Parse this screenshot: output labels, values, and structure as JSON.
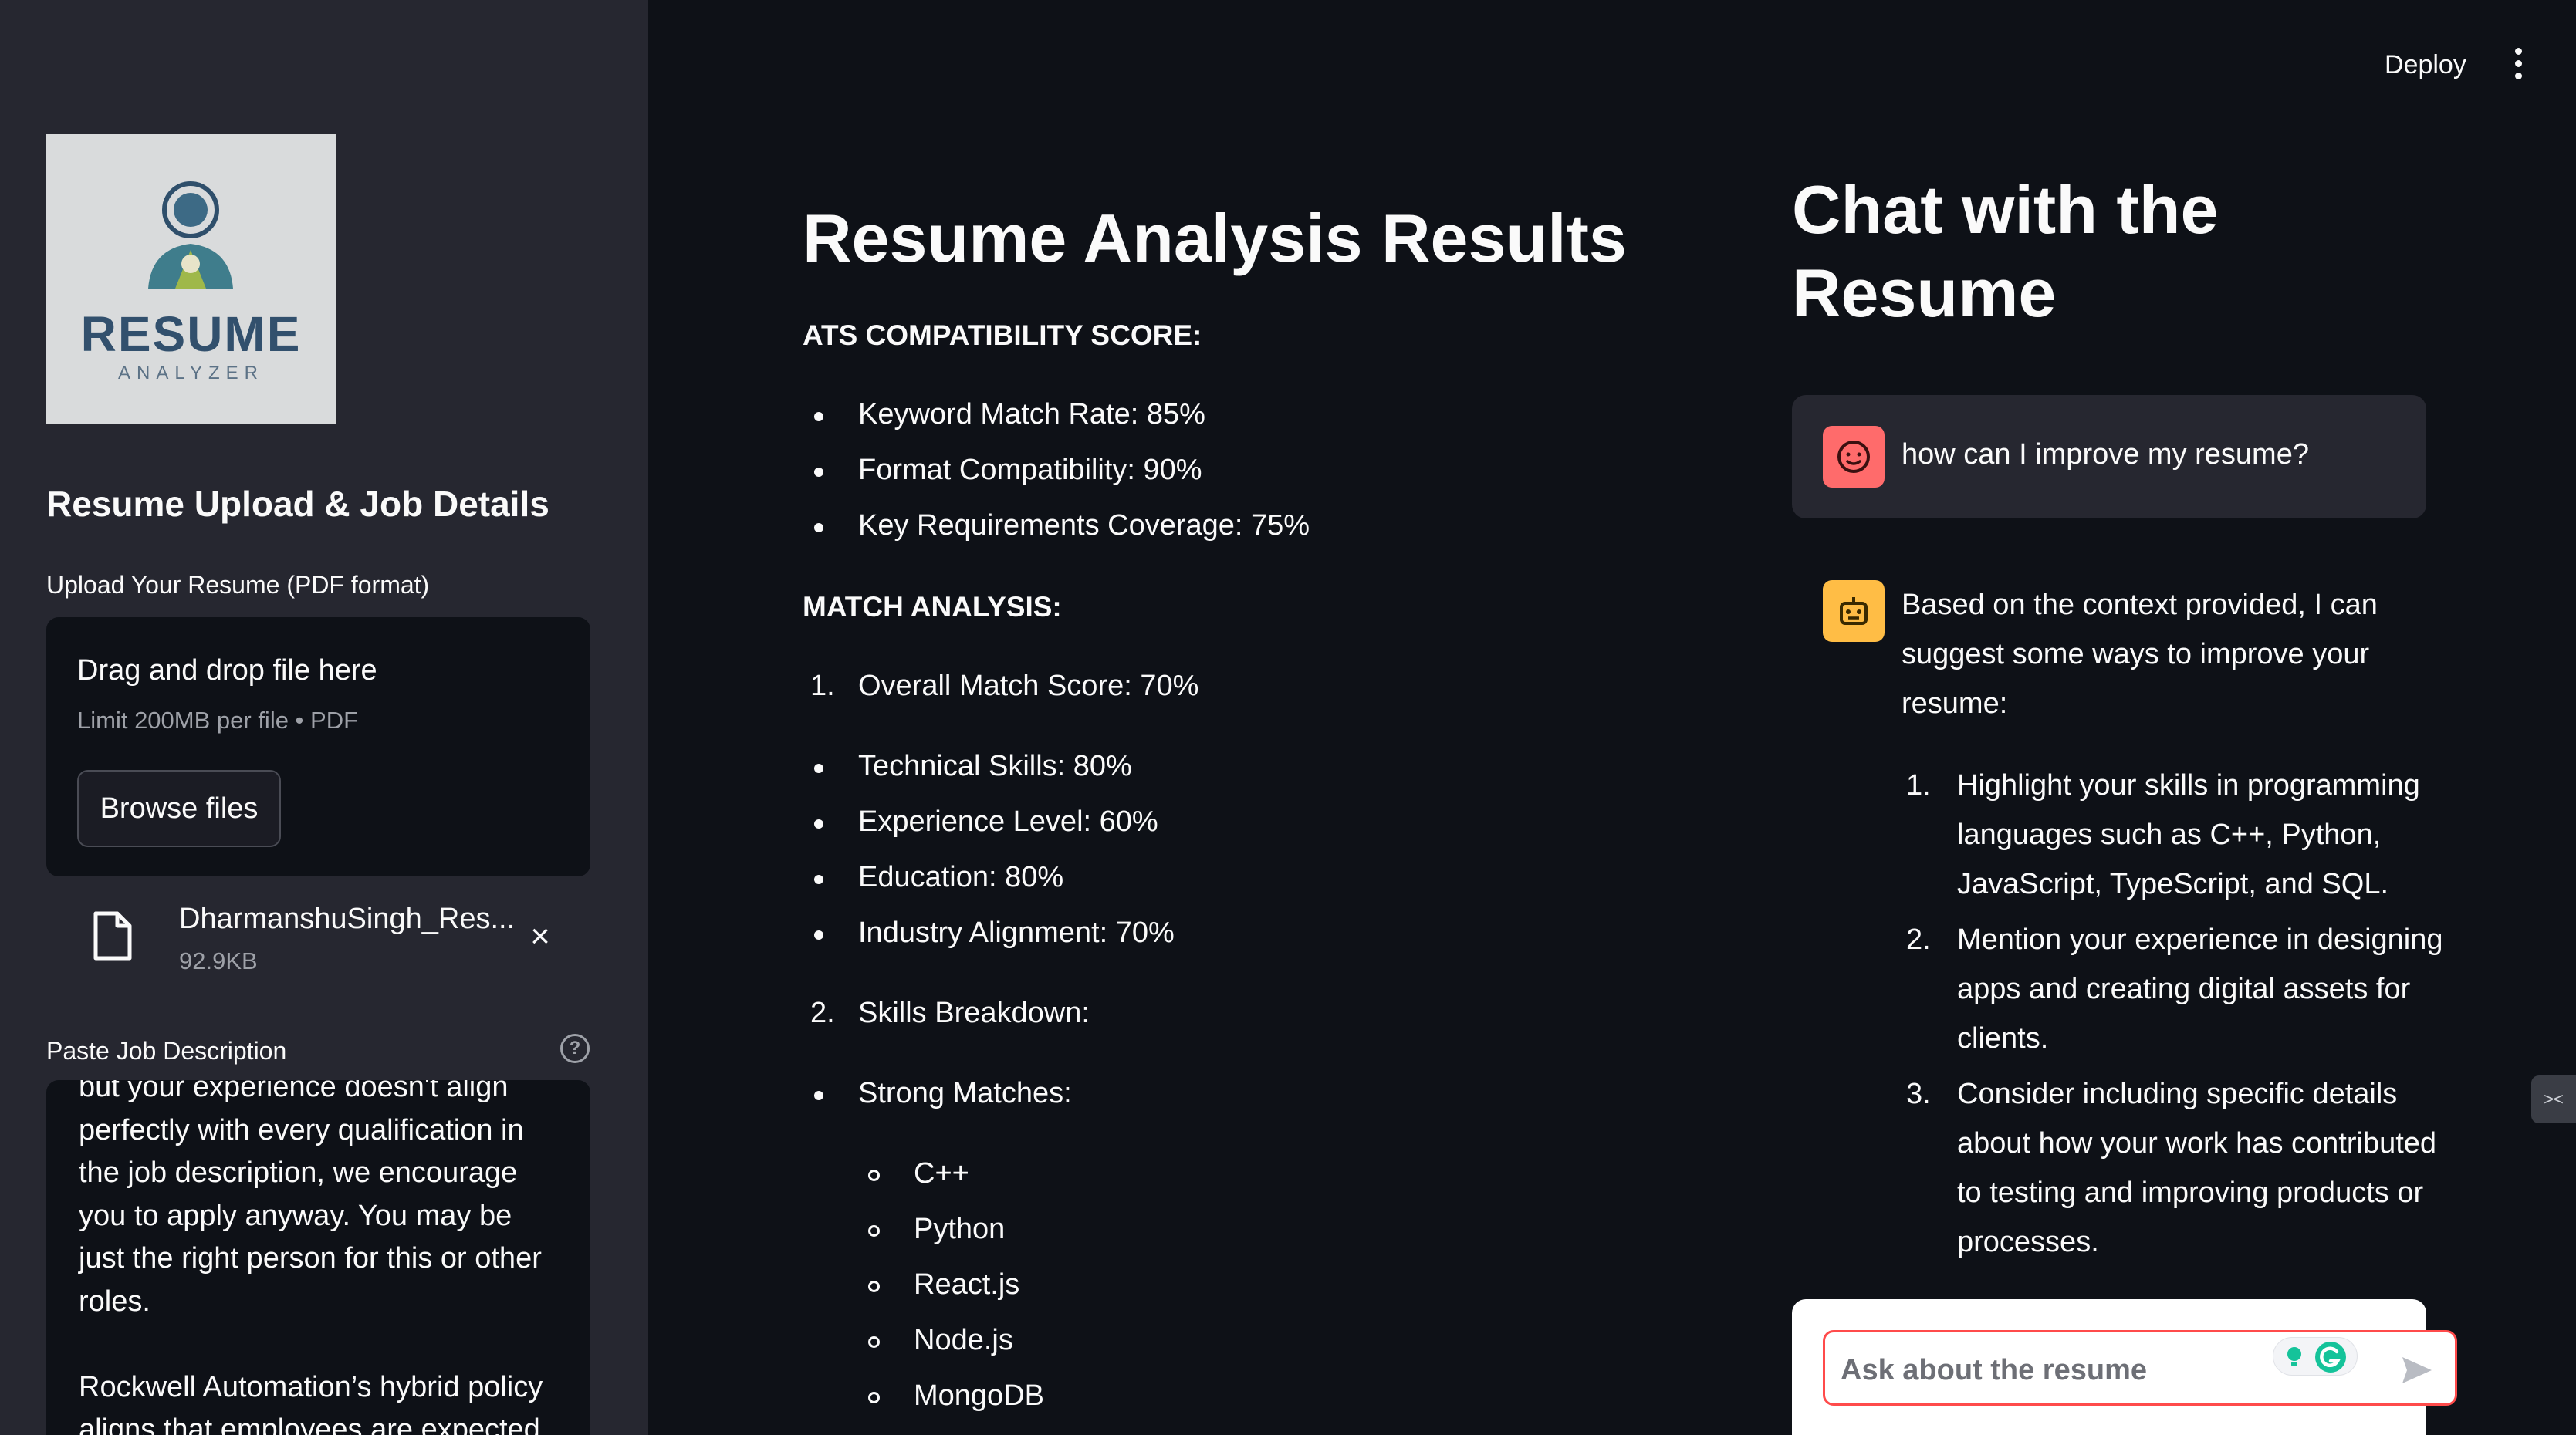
{
  "sidebar": {
    "logo": {
      "brand": "RESUME",
      "sub": "ANALYZER"
    },
    "heading": "Resume Upload & Job Details",
    "upload_label": "Upload Your Resume (PDF format)",
    "dropzone": {
      "title": "Drag and drop file here",
      "limit": "Limit 200MB per file • PDF",
      "browse_label": "Browse files"
    },
    "file": {
      "name": "DharmanshuSingh_Res...",
      "size": "92.9KB",
      "remove_icon": "×"
    },
    "jd_label": "Paste Job Description",
    "jd_help_icon": "?",
    "jd_lines": [
      "but your experience doesn't align",
      "perfectly with every qualification in",
      "the job description, we encourage",
      "you to apply anyway. You may be",
      "just the right person for this or other",
      "roles.",
      "",
      "Rockwell Automation’s hybrid policy",
      "aligns that employees are expected"
    ]
  },
  "header": {
    "deploy_label": "Deploy"
  },
  "results": {
    "title": "Resume Analysis Results",
    "ats_heading": "ATS COMPATIBILITY SCORE:",
    "ats_items": [
      "Keyword Match Rate: 85%",
      "Format Compatibility: 90%",
      "Key Requirements Coverage: 75%"
    ],
    "match_heading": "MATCH ANALYSIS:",
    "overall": {
      "num": "1.",
      "text": "Overall Match Score: 70%"
    },
    "match_items": [
      "Technical Skills: 80%",
      "Experience Level: 60%",
      "Education: 80%",
      "Industry Alignment: 70%"
    ],
    "skills": {
      "num": "2.",
      "text": "Skills Breakdown:"
    },
    "strong_label": "Strong Matches:",
    "strong_items": [
      "C++",
      "Python",
      "React.js",
      "Node.js",
      "MongoDB"
    ]
  },
  "chat": {
    "title": "Chat with the Resume",
    "user_message": "how can I improve my resume?",
    "bot_intro": "Based on the context provided, I can suggest some ways to improve your resume:",
    "bot_items": [
      {
        "num": "1.",
        "text": "Highlight your skills in programming languages such as C++, Python, JavaScript, TypeScript, and SQL."
      },
      {
        "num": "2.",
        "text": "Mention your experience in designing apps and creating digital assets for clients."
      },
      {
        "num": "3.",
        "text": "Consider including specific details about how your work has contributed to testing and improving products or processes."
      }
    ],
    "input_placeholder": "Ask about the resume",
    "colors": {
      "user_avatar": "#ff6b6b",
      "bot_avatar": "#ffbd45",
      "input_border": "#ff4b4b"
    }
  }
}
